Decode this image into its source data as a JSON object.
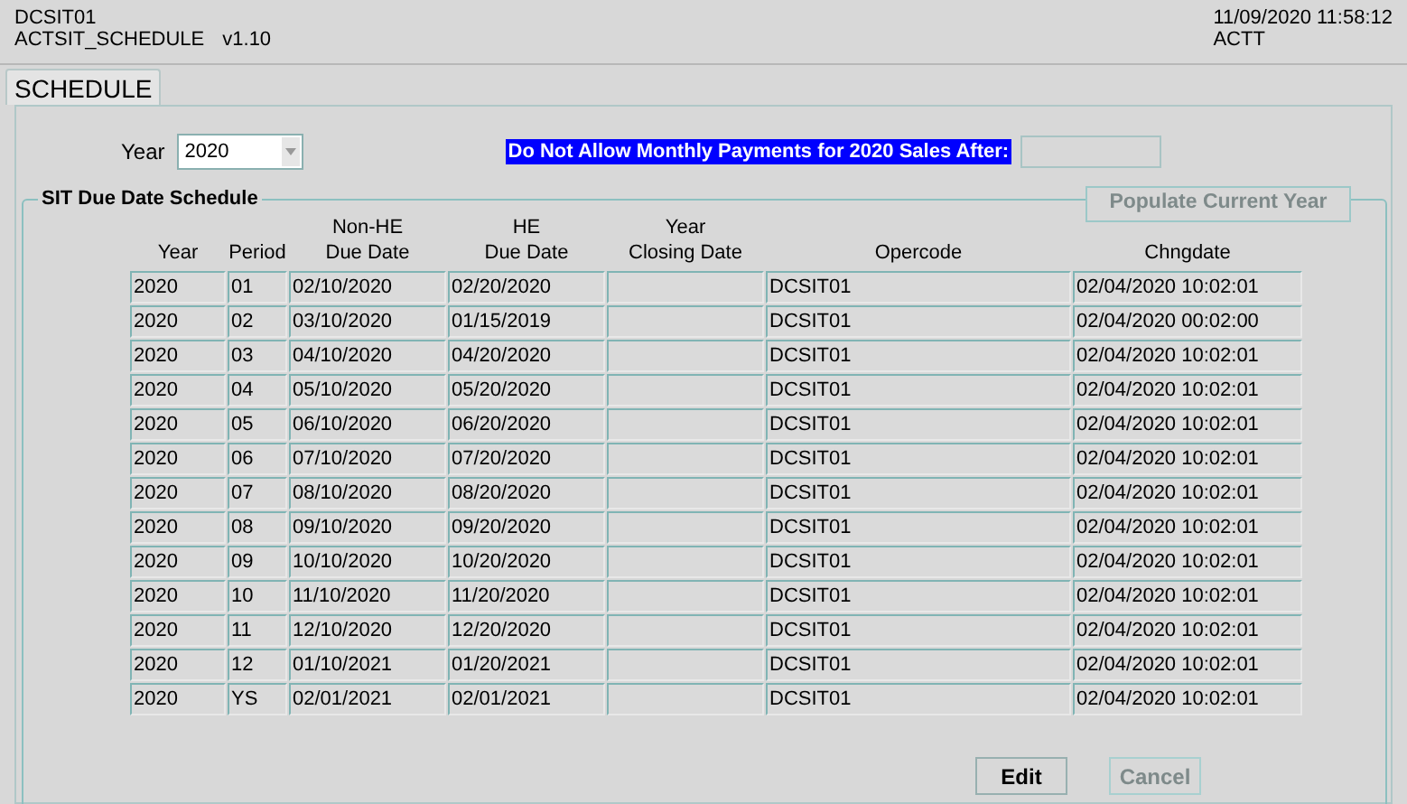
{
  "header": {
    "form_id": "DCSIT01",
    "module": "ACTSIT_SCHEDULE",
    "version": "v1.10",
    "datetime": "11/09/2020 11:58:12",
    "user": "ACTT"
  },
  "tabs": [
    {
      "label": "SCHEDULE",
      "selected": true
    }
  ],
  "year_field": {
    "label": "Year",
    "value": "2020"
  },
  "notice": {
    "label": "Do Not Allow Monthly Payments for 2020 Sales After:"
  },
  "group": {
    "title": "SIT Due Date Schedule",
    "populate_button": {
      "label": "Populate Current Year",
      "disabled": true
    }
  },
  "table": {
    "columns": [
      {
        "label": "Year"
      },
      {
        "label": "Period"
      },
      {
        "label": "Non-HE\nDue Date"
      },
      {
        "label": "HE\nDue Date"
      },
      {
        "label": "Year\nClosing Date"
      },
      {
        "label": "Opercode"
      },
      {
        "label": "Chngdate"
      }
    ],
    "rows": [
      {
        "year": "2020",
        "period": "01",
        "non_he_due_date": "02/10/2020",
        "he_due_date": "02/20/2020",
        "opercode": "DCSIT01",
        "chngdate": "02/04/2020 10:02:01"
      },
      {
        "year": "2020",
        "period": "02",
        "non_he_due_date": "03/10/2020",
        "he_due_date": "01/15/2019",
        "opercode": "DCSIT01",
        "chngdate": "02/04/2020 00:02:00"
      },
      {
        "year": "2020",
        "period": "03",
        "non_he_due_date": "04/10/2020",
        "he_due_date": "04/20/2020",
        "opercode": "DCSIT01",
        "chngdate": "02/04/2020 10:02:01"
      },
      {
        "year": "2020",
        "period": "04",
        "non_he_due_date": "05/10/2020",
        "he_due_date": "05/20/2020",
        "opercode": "DCSIT01",
        "chngdate": "02/04/2020 10:02:01"
      },
      {
        "year": "2020",
        "period": "05",
        "non_he_due_date": "06/10/2020",
        "he_due_date": "06/20/2020",
        "opercode": "DCSIT01",
        "chngdate": "02/04/2020 10:02:01"
      },
      {
        "year": "2020",
        "period": "06",
        "non_he_due_date": "07/10/2020",
        "he_due_date": "07/20/2020",
        "opercode": "DCSIT01",
        "chngdate": "02/04/2020 10:02:01"
      },
      {
        "year": "2020",
        "period": "07",
        "non_he_due_date": "08/10/2020",
        "he_due_date": "08/20/2020",
        "opercode": "DCSIT01",
        "chngdate": "02/04/2020 10:02:01"
      },
      {
        "year": "2020",
        "period": "08",
        "non_he_due_date": "09/10/2020",
        "he_due_date": "09/20/2020",
        "opercode": "DCSIT01",
        "chngdate": "02/04/2020 10:02:01"
      },
      {
        "year": "2020",
        "period": "09",
        "non_he_due_date": "10/10/2020",
        "he_due_date": "10/20/2020",
        "opercode": "DCSIT01",
        "chngdate": "02/04/2020 10:02:01"
      },
      {
        "year": "2020",
        "period": "10",
        "non_he_due_date": "11/10/2020",
        "he_due_date": "11/20/2020",
        "opercode": "DCSIT01",
        "chngdate": "02/04/2020 10:02:01"
      },
      {
        "year": "2020",
        "period": "11",
        "non_he_due_date": "12/10/2020",
        "he_due_date": "12/20/2020",
        "opercode": "DCSIT01",
        "chngdate": "02/04/2020 10:02:01"
      },
      {
        "year": "2020",
        "period": "12",
        "non_he_due_date": "01/10/2021",
        "he_due_date": "01/20/2021",
        "opercode": "DCSIT01",
        "chngdate": "02/04/2020 10:02:01"
      },
      {
        "year": "2020",
        "period": "YS",
        "non_he_due_date": "02/01/2021",
        "he_due_date": "02/01/2021",
        "opercode": "DCSIT01",
        "chngdate": "02/04/2020 10:02:01"
      }
    ]
  },
  "buttons": [
    {
      "label": "Edit",
      "disabled": false
    },
    {
      "label": "Cancel",
      "disabled": true
    }
  ]
}
